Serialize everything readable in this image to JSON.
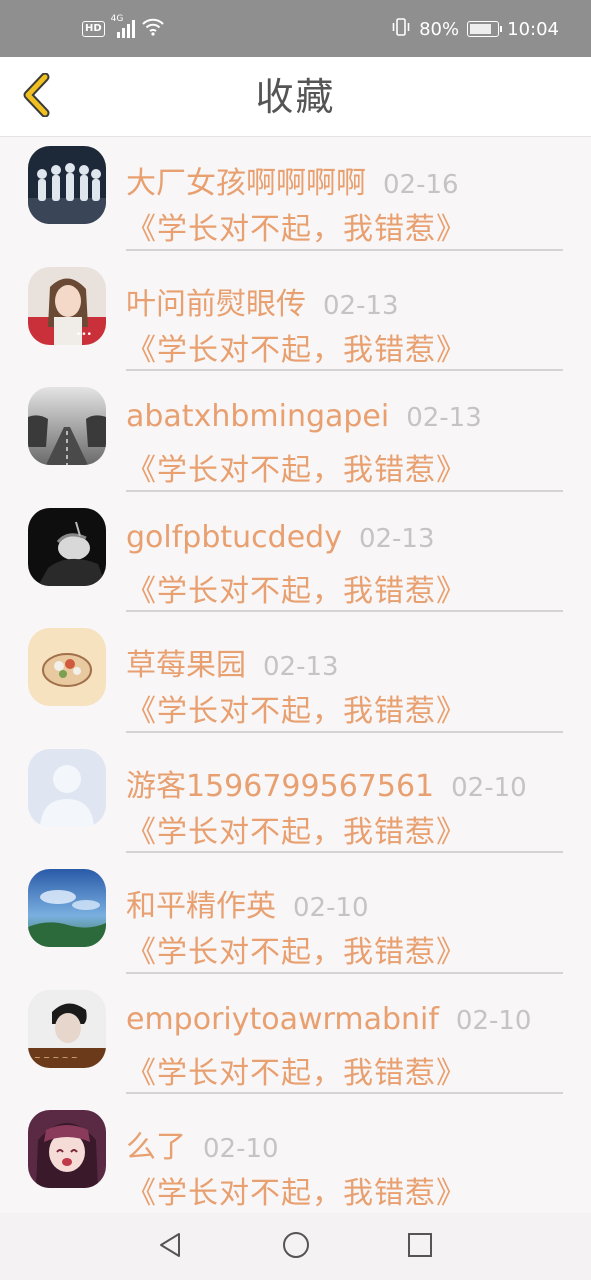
{
  "status_bar": {
    "network_hd": "HD",
    "network_type": "4G",
    "battery_percent": "80%",
    "battery_level": 0.8,
    "time": "10:04",
    "icons": [
      "hd-icon",
      "signal-icon",
      "wifi-icon",
      "vibrate-icon",
      "battery-icon"
    ]
  },
  "header": {
    "title": "收藏",
    "back_icon": "chevron-left-icon",
    "back_color": "#f0c020"
  },
  "favorites": [
    {
      "name": "大厂女孩啊啊啊啊",
      "date": "02-16",
      "book": "《学长对不起，我错惹》",
      "avatar": "group-photo-avatar"
    },
    {
      "name": "叶问前熨眼传",
      "date": "02-13",
      "book": "《学长对不起，我错惹》",
      "avatar": "girl-photo-avatar"
    },
    {
      "name": "abatxhbmingapei",
      "date": "02-13",
      "book": "《学长对不起，我错惹》",
      "avatar": "foggy-road-avatar"
    },
    {
      "name": "golfpbtucdedy",
      "date": "02-13",
      "book": "《学长对不起，我错惹》",
      "avatar": "dark-portrait-avatar"
    },
    {
      "name": "草莓果园",
      "date": "02-13",
      "book": "《学长对不起，我错惹》",
      "avatar": "food-bowl-avatar"
    },
    {
      "name": "游客1596799567561",
      "date": "02-10",
      "book": "《学长对不起，我错惹》",
      "avatar": "default-user-avatar"
    },
    {
      "name": "和平精作英",
      "date": "02-10",
      "book": "《学长对不起，我错惹》",
      "avatar": "anime-sky-avatar"
    },
    {
      "name": "emporiytoawrmabnif",
      "date": "02-10",
      "book": "《学长对不起，我错惹》",
      "avatar": "boy-portrait-avatar"
    },
    {
      "name": "么了",
      "date": "02-10",
      "book": "《学长对不起，我错惹》",
      "avatar": "anime-girl-avatar"
    }
  ],
  "nav": {
    "back": "back-triangle-icon",
    "home": "home-circle-icon",
    "recent": "recent-square-icon"
  },
  "colors": {
    "accent_text": "#e8a070",
    "date_text": "#c6c3c4",
    "status_bar_bg": "#8f8f8f"
  }
}
